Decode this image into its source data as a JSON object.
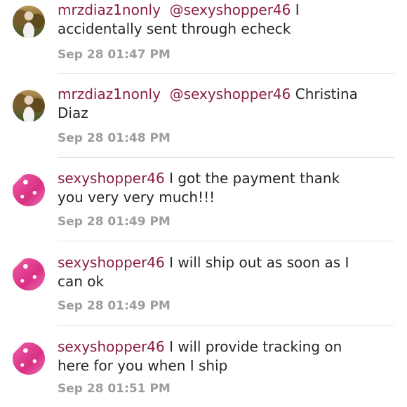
{
  "comments": [
    {
      "author": "mrzdiaz1nonly",
      "mention": "@sexyshopper46",
      "line1_rest": " I",
      "line2": "accidentally sent through echeck",
      "timestamp": "Sep 28 01:47 PM",
      "avatar": "user-avatar"
    },
    {
      "author": "mrzdiaz1nonly",
      "mention": "@sexyshopper46",
      "line1_rest": " Christina",
      "line2": "Diaz",
      "timestamp": "Sep 28 01:48 PM",
      "avatar": "user-avatar"
    },
    {
      "author": "sexyshopper46",
      "line1_rest": "  I got the payment thank",
      "line2": "you very very much!!!",
      "timestamp": "Sep 28 01:49 PM",
      "avatar": "shopper-avatar"
    },
    {
      "author": "sexyshopper46",
      "line1_rest": "  I will ship out as soon as I",
      "line2": "can ok",
      "timestamp": "Sep 28 01:49 PM",
      "avatar": "shopper-avatar"
    },
    {
      "author": "sexyshopper46",
      "line1_rest": "  I will provide tracking on",
      "line2": "here for you when I ship",
      "timestamp": "Sep 28 01:51 PM",
      "avatar": "shopper-avatar"
    }
  ],
  "colors": {
    "username": "#8b1e45",
    "text": "#262626",
    "timestamp": "#9c9c9c",
    "divider": "#e3e3e3"
  }
}
